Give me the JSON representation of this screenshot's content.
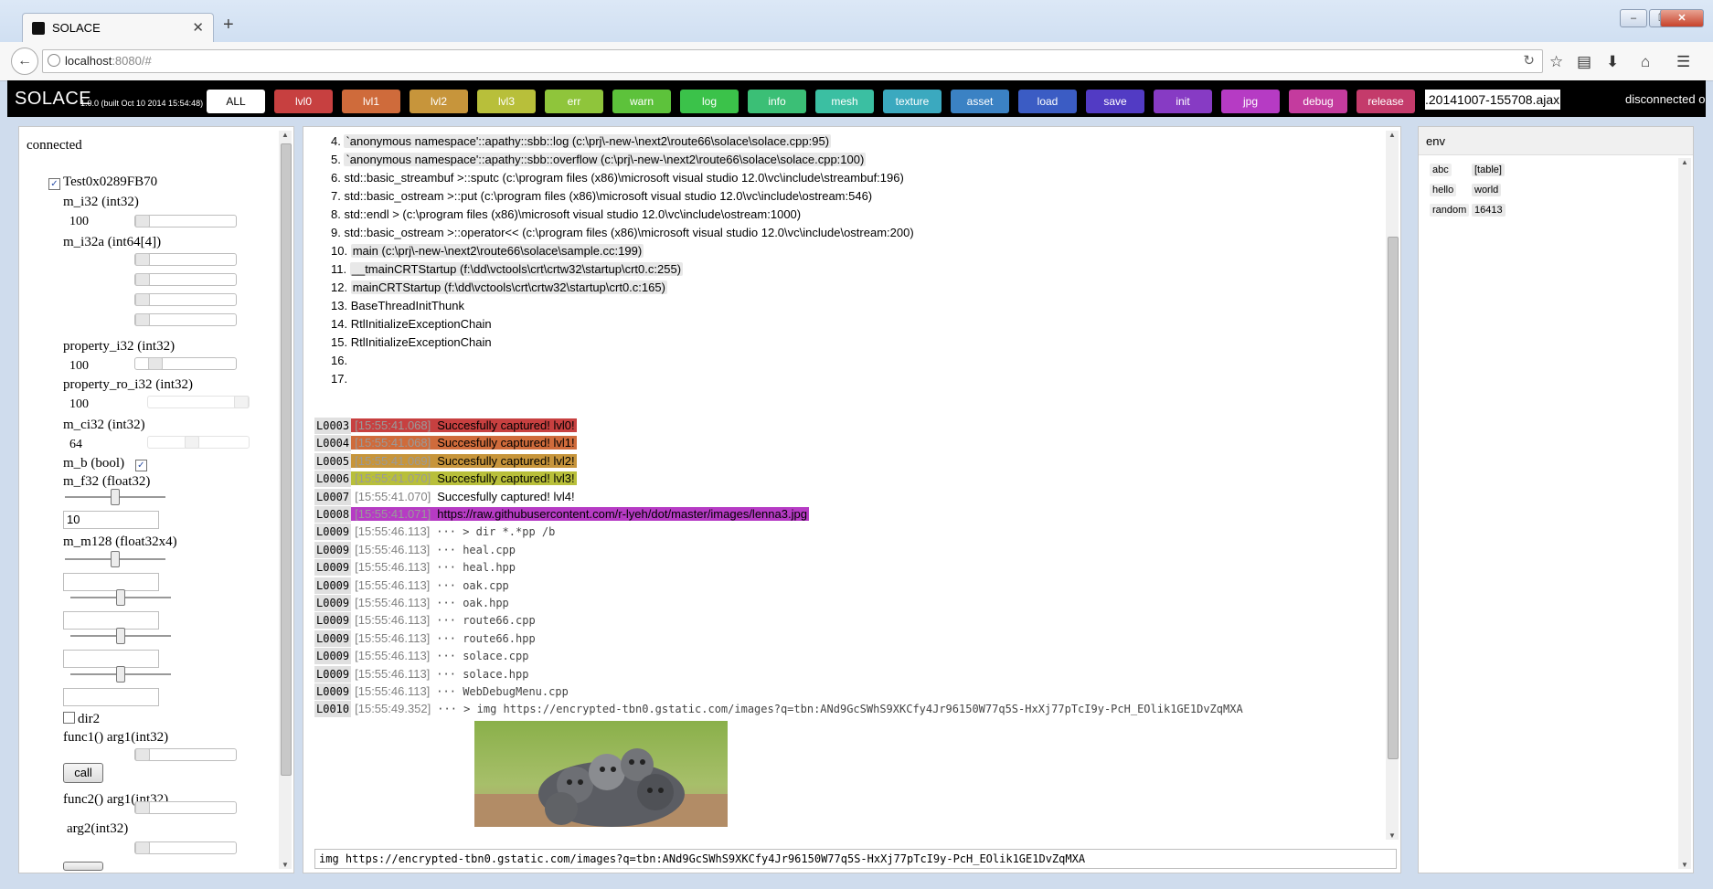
{
  "browser": {
    "tab_title": "SOLACE",
    "url_host": "localhost",
    "url_rest": ":8080/#"
  },
  "appbar": {
    "logo": "SOLACE",
    "version": "1.0.0 (built Oct 10 2014 15:54:48)",
    "filters": [
      {
        "label": "ALL",
        "color": "#ffffff"
      },
      {
        "label": "lvl0",
        "color": "#c74040"
      },
      {
        "label": "lvl1",
        "color": "#cf6b3b"
      },
      {
        "label": "lvl2",
        "color": "#c7953b"
      },
      {
        "label": "lvl3",
        "color": "#b8bf3a"
      },
      {
        "label": "err",
        "color": "#8fc53b"
      },
      {
        "label": "warn",
        "color": "#5dc23b"
      },
      {
        "label": "log",
        "color": "#3bc24a"
      },
      {
        "label": "info",
        "color": "#3bbf76"
      },
      {
        "label": "mesh",
        "color": "#3bbfa2"
      },
      {
        "label": "texture",
        "color": "#3ba9bf"
      },
      {
        "label": "asset",
        "color": "#3b82c4"
      },
      {
        "label": "load",
        "color": "#3b5cc4"
      },
      {
        "label": "save",
        "color": "#523bc4"
      },
      {
        "label": "init",
        "color": "#873bc4"
      },
      {
        "label": "jpg",
        "color": "#b63bc4"
      },
      {
        "label": "debug",
        "color": "#c43b9e"
      },
      {
        "label": "release",
        "color": "#c43b6b"
      }
    ],
    "session_file": ".20141007-155708.ajax",
    "status": "disconnected o"
  },
  "left": {
    "status": "connected",
    "root": "Test0x0289FB70",
    "m_i32_label": "m_i32 (int32)",
    "m_i32_value": "100",
    "m_i32a_label": "m_i32a (int64[4])",
    "property_i32_label": "property_i32 (int32)",
    "property_i32_value": "100",
    "property_ro_i32_label": "property_ro_i32 (int32)",
    "property_ro_i32_value": "100",
    "m_ci32_label": "m_ci32 (int32)",
    "m_ci32_value": "64",
    "m_b_label": "m_b (bool)",
    "m_f32_label": "m_f32 (float32)",
    "m_f32_value": "10",
    "m_m128_label": "m_m128 (float32x4)",
    "dir2_label": "dir2",
    "func1_label": "func1() arg1(int32)",
    "call_label": "call",
    "func2_label": "func2() arg1(int32)",
    "arg2_label": "arg2(int32)"
  },
  "center": {
    "trace": [
      {
        "n": "4.",
        "text": "`anonymous namespace'::apathy::sbb::log (c:\\prj\\-new-\\next2\\route66\\solace\\solace.cpp:95)",
        "hl": true
      },
      {
        "n": "5.",
        "text": "`anonymous namespace'::apathy::sbb::overflow (c:\\prj\\-new-\\next2\\route66\\solace\\solace.cpp:100)",
        "hl": true
      },
      {
        "n": "6.",
        "text": "std::basic_streambuf >::sputc (c:\\program files (x86)\\microsoft visual studio 12.0\\vc\\include\\streambuf:196)",
        "hl": false
      },
      {
        "n": "7.",
        "text": "std::basic_ostream >::put (c:\\program files (x86)\\microsoft visual studio 12.0\\vc\\include\\ostream:546)",
        "hl": false
      },
      {
        "n": "8.",
        "text": "std::endl > (c:\\program files (x86)\\microsoft visual studio 12.0\\vc\\include\\ostream:1000)",
        "hl": false
      },
      {
        "n": "9.",
        "text": "std::basic_ostream >::operator<< (c:\\program files (x86)\\microsoft visual studio 12.0\\vc\\include\\ostream:200)",
        "hl": false
      },
      {
        "n": "10.",
        "text": "main (c:\\prj\\-new-\\next2\\route66\\solace\\sample.cc:199)",
        "hl": true
      },
      {
        "n": "11.",
        "text": "__tmainCRTStartup (f:\\dd\\vctools\\crt\\crtw32\\startup\\crt0.c:255)",
        "hl": true
      },
      {
        "n": "12.",
        "text": "mainCRTStartup (f:\\dd\\vctools\\crt\\crtw32\\startup\\crt0.c:165)",
        "hl": true
      },
      {
        "n": "13.",
        "text": "BaseThreadInitThunk",
        "hl": false
      },
      {
        "n": "14.",
        "text": "RtlInitializeExceptionChain",
        "hl": false
      },
      {
        "n": "15.",
        "text": "RtlInitializeExceptionChain",
        "hl": false
      },
      {
        "n": "16.",
        "text": "",
        "hl": false
      },
      {
        "n": "17.",
        "text": "",
        "hl": false
      }
    ],
    "logs": [
      {
        "id": "L0003",
        "ts": "[15:55:41.068]",
        "msg": "Succesfully captured! lvl0!",
        "bg": "#c74040",
        "mono": false
      },
      {
        "id": "L0004",
        "ts": "[15:55:41.068]",
        "msg": "Succesfully captured! lvl1!",
        "bg": "#cf6b3b",
        "mono": false
      },
      {
        "id": "L0005",
        "ts": "[15:55:41.069]",
        "msg": "Succesfully captured! lvl2!",
        "bg": "#c7953b",
        "mono": false
      },
      {
        "id": "L0006",
        "ts": "[15:55:41.070]",
        "msg": "Succesfully captured! lvl3!",
        "bg": "#b8bf3a",
        "mono": false
      },
      {
        "id": "L0007",
        "ts": "[15:55:41.070]",
        "msg": "Succesfully captured! lvl4!",
        "bg": "",
        "mono": false
      },
      {
        "id": "L0008",
        "ts": "[15:55:41.071]",
        "msg": "https://raw.githubusercontent.com/r-lyeh/dot/master/images/lenna3.jpg",
        "bg": "#b63bc4",
        "mono": false
      },
      {
        "id": "L0009",
        "ts": "[15:55:46.113]",
        "msg": "··· > dir *.*pp /b",
        "bg": "",
        "mono": true
      },
      {
        "id": "L0009",
        "ts": "[15:55:46.113]",
        "msg": "··· heal.cpp",
        "bg": "",
        "mono": true
      },
      {
        "id": "L0009",
        "ts": "[15:55:46.113]",
        "msg": "··· heal.hpp",
        "bg": "",
        "mono": true
      },
      {
        "id": "L0009",
        "ts": "[15:55:46.113]",
        "msg": "··· oak.cpp",
        "bg": "",
        "mono": true
      },
      {
        "id": "L0009",
        "ts": "[15:55:46.113]",
        "msg": "··· oak.hpp",
        "bg": "",
        "mono": true
      },
      {
        "id": "L0009",
        "ts": "[15:55:46.113]",
        "msg": "··· route66.cpp",
        "bg": "",
        "mono": true
      },
      {
        "id": "L0009",
        "ts": "[15:55:46.113]",
        "msg": "··· route66.hpp",
        "bg": "",
        "mono": true
      },
      {
        "id": "L0009",
        "ts": "[15:55:46.113]",
        "msg": "··· solace.cpp",
        "bg": "",
        "mono": true
      },
      {
        "id": "L0009",
        "ts": "[15:55:46.113]",
        "msg": "··· solace.hpp",
        "bg": "",
        "mono": true
      },
      {
        "id": "L0009",
        "ts": "[15:55:46.113]",
        "msg": "··· WebDebugMenu.cpp",
        "bg": "",
        "mono": true
      },
      {
        "id": "L0010",
        "ts": "[15:55:49.352]",
        "msg": "··· > img https://encrypted-tbn0.gstatic.com/images?q=tbn:ANd9GcSWhS9XKCfy4Jr96150W77q5S-HxXj77pTcI9y-PcH_EOlik1GE1DvZqMXA",
        "bg": "",
        "mono": true
      }
    ],
    "command": "img https://encrypted-tbn0.gstatic.com/images?q=tbn:ANd9GcSWhS9XKCfy4Jr96150W77q5S-HxXj77pTcI9y-PcH_EOlik1GE1DvZqMXA"
  },
  "right": {
    "tab": "env",
    "rows": [
      {
        "k": "abc",
        "v": "[table]"
      },
      {
        "k": "hello",
        "v": "world"
      },
      {
        "k": "random",
        "v": "16413"
      }
    ]
  },
  "icons": [
    "favicon-icon",
    "close-tab-icon",
    "new-tab-icon",
    "back-icon",
    "globe-icon",
    "reload-icon",
    "bookmark-star-icon",
    "reading-list-icon",
    "download-icon",
    "home-icon",
    "menu-icon"
  ]
}
